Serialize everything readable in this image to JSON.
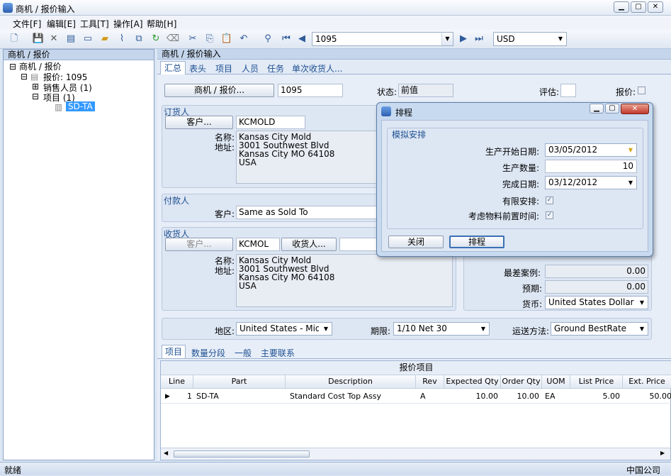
{
  "window": {
    "title": "商机 / 报价输入"
  },
  "menu": [
    "文件[F]",
    "编辑[E]",
    "工具[T]",
    "操作[A]",
    "帮助[H]"
  ],
  "toolbar": {
    "record_value": "1095",
    "currency_value": "USD"
  },
  "left_pane": {
    "header": "商机 / 报价",
    "tree": {
      "root": "商机 / 报价",
      "quote": "报价: 1095",
      "salespeople": "销售人员 (1)",
      "items": "项目 (1)",
      "item_node": "SD-TA"
    }
  },
  "right_pane": {
    "header": "商机 / 报价输入",
    "tabs": [
      "汇总",
      "表头",
      "项目",
      "人员",
      "任务",
      "单次收货人..."
    ],
    "top_row": {
      "opportunity_button": "商机 / 报价...",
      "opportunity_value": "1095",
      "status_label": "状态:",
      "status_value": "前值",
      "evaluate_label": "评估:",
      "quote_label": "报价:"
    },
    "sold_to": {
      "title": "订货人",
      "customer_button": "客户...",
      "customer_id": "KCMOLD",
      "name_label": "名称:",
      "address_label": "地址:",
      "address_lines": [
        "Kansas City Mold",
        "3001 Southwest Blvd",
        "Kansas City MO 64108",
        "USA"
      ]
    },
    "bill_to": {
      "title": "付款人",
      "customer_label": "客户:",
      "customer_value": "Same as Sold To"
    },
    "ship_to": {
      "title": "收货人",
      "customer_button": "客户...",
      "customer_id": "KCMOL",
      "shipto_button": "收货人...",
      "name_label": "名称:",
      "address_label": "地址:",
      "address_lines": [
        "Kansas City Mold",
        "3001 Southwest Blvd",
        "Kansas City MO 64108",
        "USA"
      ]
    },
    "totals": {
      "worst_case_label": "最差案例:",
      "worst_case_value": "0.00",
      "expected_label": "预期:",
      "expected_value": "0.00",
      "currency_label": "货币:",
      "currency_value": "United States Dollar"
    },
    "bottom_row": {
      "territory_label": "地区:",
      "territory_value": "United States - Mid Wes",
      "terms_label": "期限:",
      "terms_value": "1/10 Net 30",
      "ship_via_label": "运送方法:",
      "ship_via_value": "Ground BestRate"
    },
    "sub_tabs": [
      "项目",
      "数量分段",
      "一般",
      "主要联系"
    ],
    "grid": {
      "title": "报价项目",
      "columns": [
        "Line",
        "Part",
        "Description",
        "Rev",
        "Expected Qty",
        "Order Qty",
        "UOM",
        "List Price",
        "Ext. Price"
      ],
      "rows": [
        {
          "line": "1",
          "part": "SD-TA",
          "description": "Standard Cost Top Assy",
          "rev": "A",
          "expected_qty": "10.00",
          "order_qty": "10.00",
          "uom": "EA",
          "list_price": "5.00",
          "ext_price": "50.00"
        }
      ]
    }
  },
  "dialog": {
    "title": "排程",
    "group_title": "模拟安排",
    "start_date_label": "生产开始日期:",
    "start_date_value": "03/05/2012",
    "qty_label": "生产数量:",
    "qty_value": "10",
    "finish_date_label": "完成日期:",
    "finish_date_value": "03/12/2012",
    "finite_label": "有限安排:",
    "lead_time_label": "考虑物料前置时间:",
    "close_button": "关闭",
    "schedule_button": "排程"
  },
  "status": {
    "left": "就绪",
    "right": "中国公司"
  },
  "colors": {
    "accent": "#1d4f91",
    "selection": "#3399ff"
  }
}
